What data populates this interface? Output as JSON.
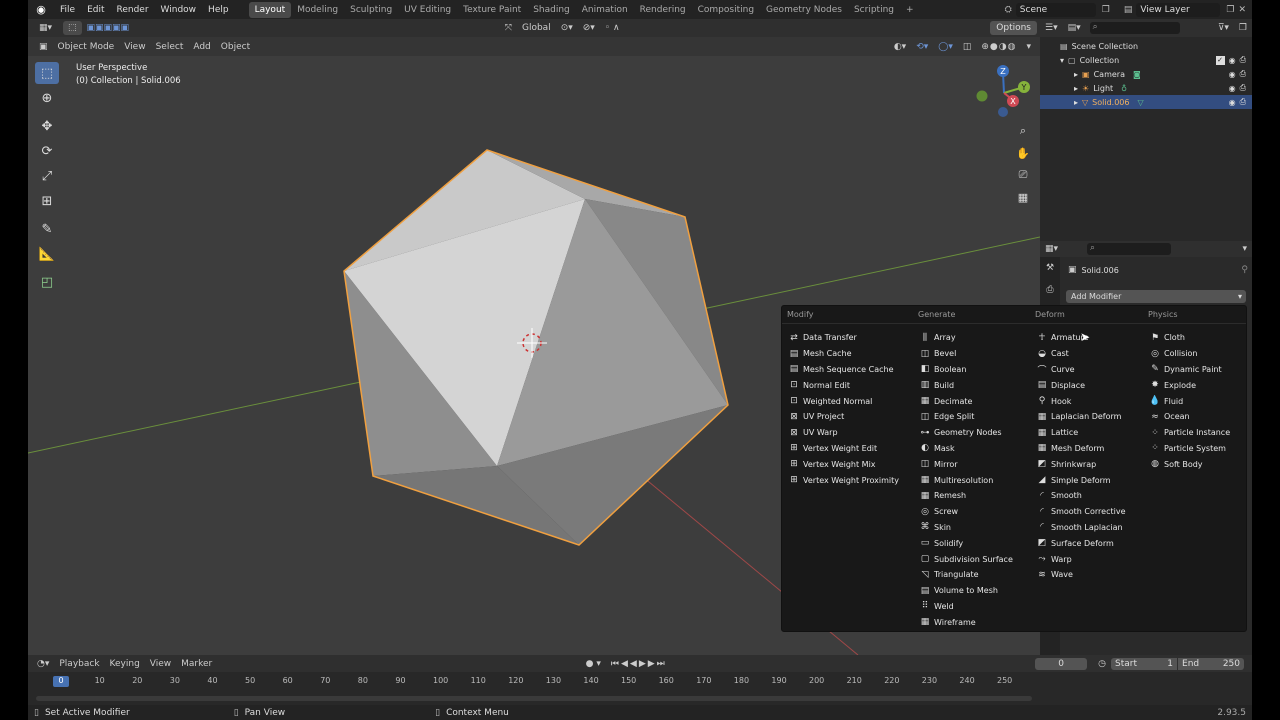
{
  "topbar": {
    "menus": [
      "File",
      "Edit",
      "Render",
      "Window",
      "Help"
    ],
    "workspaces": [
      "Layout",
      "Modeling",
      "Sculpting",
      "UV Editing",
      "Texture Paint",
      "Shading",
      "Animation",
      "Rendering",
      "Compositing",
      "Geometry Nodes",
      "Scripting"
    ],
    "active_workspace": "Layout",
    "add_tab": "+",
    "scene": "Scene",
    "view_layer": "View Layer"
  },
  "vp_header": {
    "transform_orientation": "Global",
    "options": "Options",
    "mode": "Object Mode",
    "menus": [
      "View",
      "Select",
      "Add",
      "Object"
    ]
  },
  "viewport": {
    "perspective_label": "User Perspective",
    "collection_label": "(0) Collection | Solid.006"
  },
  "outliner": {
    "rows": [
      {
        "label": "Scene Collection",
        "icon": "scene-collection-icon"
      },
      {
        "label": "Collection",
        "icon": "collection-icon"
      },
      {
        "label": "Camera",
        "icon": "camera-icon"
      },
      {
        "label": "Light",
        "icon": "light-icon"
      },
      {
        "label": "Solid.006",
        "icon": "mesh-icon",
        "selected": true
      }
    ]
  },
  "properties": {
    "object_name": "Solid.006",
    "add_modifier": "Add Modifier"
  },
  "modifier_menu": {
    "columns": [
      {
        "title": "Modify",
        "items": [
          "Data Transfer",
          "Mesh Cache",
          "Mesh Sequence Cache",
          "Normal Edit",
          "Weighted Normal",
          "UV Project",
          "UV Warp",
          "Vertex Weight Edit",
          "Vertex Weight Mix",
          "Vertex Weight Proximity"
        ]
      },
      {
        "title": "Generate",
        "items": [
          "Array",
          "Bevel",
          "Boolean",
          "Build",
          "Decimate",
          "Edge Split",
          "Geometry Nodes",
          "Mask",
          "Mirror",
          "Multiresolution",
          "Remesh",
          "Screw",
          "Skin",
          "Solidify",
          "Subdivision Surface",
          "Triangulate",
          "Volume to Mesh",
          "Weld",
          "Wireframe"
        ]
      },
      {
        "title": "Deform",
        "items": [
          "Armature",
          "Cast",
          "Curve",
          "Displace",
          "Hook",
          "Laplacian Deform",
          "Lattice",
          "Mesh Deform",
          "Shrinkwrap",
          "Simple Deform",
          "Smooth",
          "Smooth Corrective",
          "Smooth Laplacian",
          "Surface Deform",
          "Warp",
          "Wave"
        ]
      },
      {
        "title": "Physics",
        "items": [
          "Cloth",
          "Collision",
          "Dynamic Paint",
          "Explode",
          "Fluid",
          "Ocean",
          "Particle Instance",
          "Particle System",
          "Soft Body"
        ]
      }
    ]
  },
  "timeline": {
    "menus": [
      "Playback",
      "Keying",
      "View",
      "Marker"
    ],
    "current_frame": "0",
    "start_label": "Start",
    "start_value": "1",
    "end_label": "End",
    "end_value": "250",
    "ticks": [
      "0",
      "10",
      "20",
      "30",
      "40",
      "50",
      "60",
      "70",
      "80",
      "90",
      "100",
      "110",
      "120",
      "130",
      "140",
      "150",
      "160",
      "170",
      "180",
      "190",
      "200",
      "210",
      "220",
      "230",
      "240",
      "250"
    ],
    "playhead": "0"
  },
  "statusbar": {
    "hint1": "Set Active Modifier",
    "hint2": "Pan View",
    "hint3": "Context Menu",
    "version": "2.93.5"
  }
}
